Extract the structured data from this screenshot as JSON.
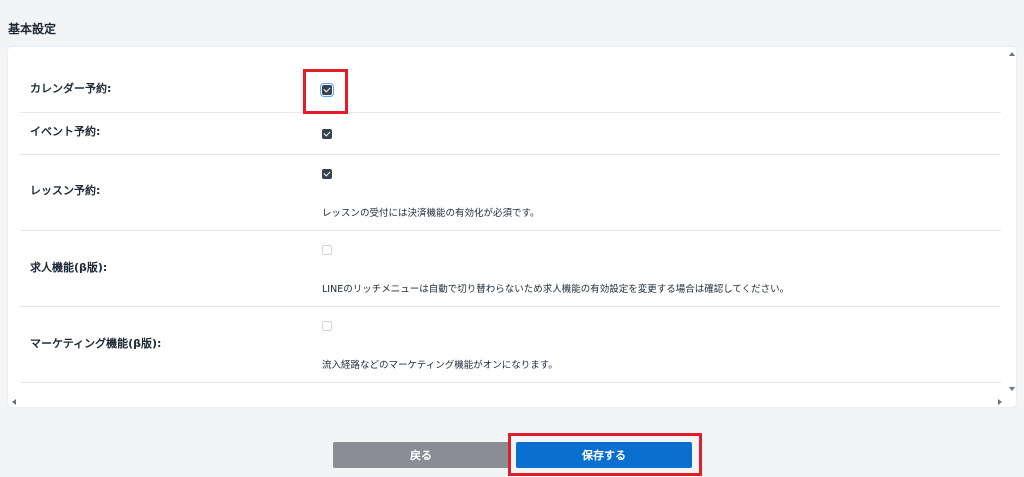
{
  "section": {
    "title": "基本設定"
  },
  "rows": [
    {
      "label": "カレンダー予約:",
      "checked": true,
      "note": ""
    },
    {
      "label": "イベント予約:",
      "checked": true,
      "note": ""
    },
    {
      "label": "レッスン予約:",
      "checked": true,
      "note": "レッスンの受付には決済機能の有効化が必須です。"
    },
    {
      "label": "求人機能(β版):",
      "checked": false,
      "note": "LINEのリッチメニューは自動で切り替わらないため求人機能の有効設定を変更する場合は確認してください。"
    },
    {
      "label": "マーケティング機能(β版):",
      "checked": false,
      "note": "流入経路などのマーケティング機能がオンになります。"
    }
  ],
  "buttons": {
    "back_label": "戻る",
    "save_label": "保存する"
  },
  "colors": {
    "highlight": "#e11d2a",
    "save_button": "#0b6fcf",
    "back_button": "#8a8d94",
    "checkbox_checked": "#374151"
  }
}
